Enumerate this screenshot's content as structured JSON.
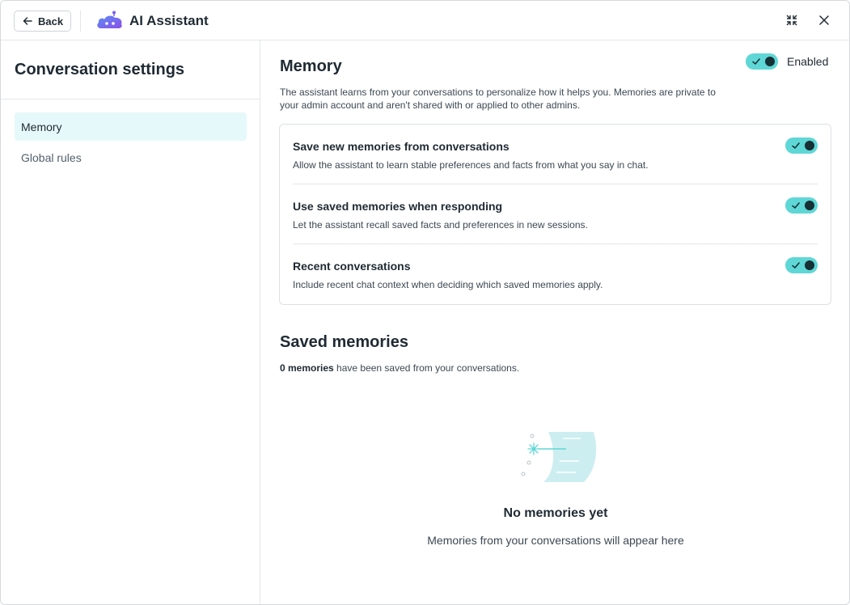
{
  "header": {
    "back_label": "Back",
    "app_title": "AI Assistant",
    "icons": [
      "arrow-left-icon",
      "robot-logo-icon",
      "minimize-icon",
      "close-icon"
    ]
  },
  "sidebar": {
    "title": "Conversation settings",
    "items": [
      {
        "label": "Memory",
        "active": true
      },
      {
        "label": "Global rules",
        "active": false
      }
    ]
  },
  "memory": {
    "title": "Memory",
    "enabled_label": "Enabled",
    "enabled": true,
    "description": "The assistant learns from your conversations to personalize how it helps you. Memories are private to your admin account and aren't shared with or applied to other admins.",
    "settings": [
      {
        "title": "Save new memories from conversations",
        "description": "Allow the assistant to learn stable preferences and facts from what you say in chat.",
        "enabled": true
      },
      {
        "title": "Use saved memories when responding",
        "description": "Let the assistant recall saved facts and preferences in new sessions.",
        "enabled": true
      },
      {
        "title": "Recent conversations",
        "description": "Include recent chat context when deciding which saved memories apply.",
        "enabled": true
      }
    ]
  },
  "saved": {
    "title": "Saved memories",
    "count_bold": "0 memories",
    "count_rest": " have been saved from your conversations.",
    "empty_title": "No memories yet",
    "empty_desc": "Memories from your conversations will appear here"
  },
  "colors": {
    "accent": "#5fd7d6",
    "active_bg": "#e6f9fa",
    "knob": "#163035",
    "logo": "#7b5cf0"
  }
}
